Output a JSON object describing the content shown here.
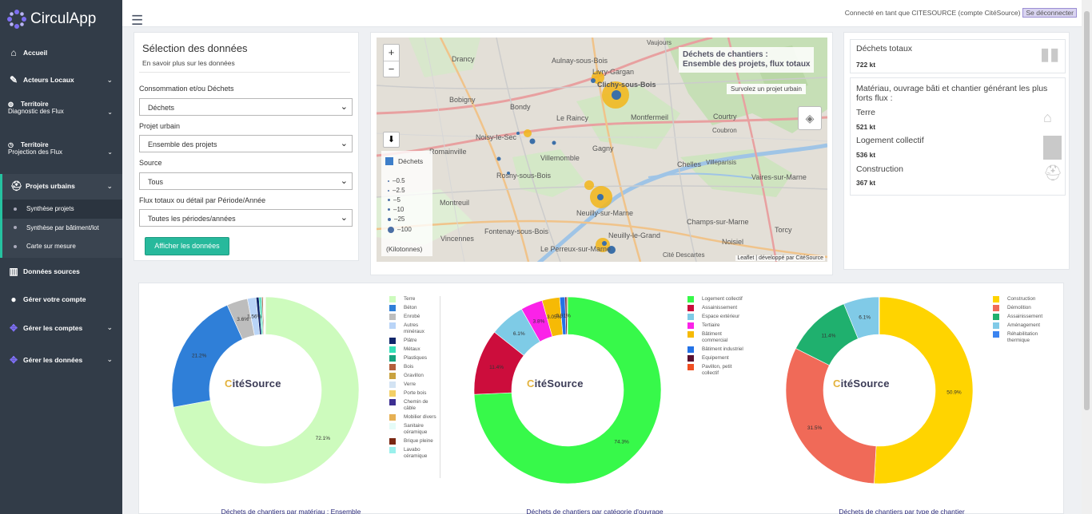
{
  "app": {
    "name": "CirculApp"
  },
  "header": {
    "connected_text": "Connecté en tant que CITESOURCE (compte CitéSource)",
    "logout_label": "Se déconnecter"
  },
  "sidebar": {
    "accueil": "Accueil",
    "acteurs": "Acteurs Locaux",
    "territoire1": {
      "title": "Territoire",
      "sub": "Diagnostic des Flux"
    },
    "territoire2": {
      "title": "Territoire",
      "sub": "Projection des Flux"
    },
    "projets": "Projets urbains",
    "sub_items": [
      "Synthèse projets",
      "Synthèse par bâtiment/lot",
      "Carte sur mesure"
    ],
    "donnees_sources": "Données sources",
    "gerer_compte": "Gérer votre compte",
    "gerer_comptes": "Gérer les comptes",
    "gerer_donnees": "Gérer les données"
  },
  "selection": {
    "title": "Sélection des données",
    "subtitle": "En savoir plus sur les données",
    "f1_label": "Consommation et/ou Déchets",
    "f1_value": "Déchets",
    "f2_label": "Projet urbain",
    "f2_value": "Ensemble des projets",
    "f3_label": "Source",
    "f3_value": "Tous",
    "f4_label": "Flux totaux ou détail par Période/Année",
    "f4_value": "Toutes les périodes/années",
    "button": "Afficher les données"
  },
  "map": {
    "zoom_in": "+",
    "zoom_out": "−",
    "title_l1": "Déchets de chantiers :",
    "title_l2": "Ensemble des projets, flux totaux",
    "survol": "Survolez un projet urbain",
    "legend_head": "Déchets",
    "legend_values": [
      "0.5",
      "2.5",
      "5",
      "10",
      "25",
      "100"
    ],
    "legend_unit": "(Kilotonnes)",
    "attribution": "Leaflet | développé par CitéSource",
    "towns": [
      {
        "n": "Drancy"
      },
      {
        "n": "Aulnay-sous-Bois"
      },
      {
        "n": "Livry-Gargan"
      },
      {
        "n": "Clichy-sous-Bois"
      },
      {
        "n": "Vaujours"
      },
      {
        "n": "Bobigny"
      },
      {
        "n": "Bondy"
      },
      {
        "n": "Le Raincy"
      },
      {
        "n": "Montfermeil"
      },
      {
        "n": "Noisy-le-Sec"
      },
      {
        "n": "Romainville"
      },
      {
        "n": "Villemomble"
      },
      {
        "n": "Gagny"
      },
      {
        "n": "Courtry"
      },
      {
        "n": "Rosny-sous-Bois"
      },
      {
        "n": "Chelles"
      },
      {
        "n": "Vaires-sur-Marne"
      },
      {
        "n": "Montreuil"
      },
      {
        "n": "Neuilly-sur-Marne"
      },
      {
        "n": "Fontenay-sous-Bois"
      },
      {
        "n": "Champs-sur-Marne"
      },
      {
        "n": "Vincennes"
      },
      {
        "n": "Neuilly-le-Grand"
      },
      {
        "n": "Noisiel"
      },
      {
        "n": "Torcy"
      },
      {
        "n": "Le Perreux-sur-Marne"
      },
      {
        "n": "Cité Descartes"
      },
      {
        "n": "Coubron"
      },
      {
        "n": "Villeparisis"
      }
    ]
  },
  "kpis": {
    "total_label": "Déchets totaux",
    "total_value": "722 kt",
    "max_title": "Matériau, ouvrage bâti et chantier générant les plus forts flux :",
    "items": [
      {
        "label": "Terre",
        "value": "521 kt"
      },
      {
        "label": "Logement collectif",
        "value": "536 kt"
      },
      {
        "label": "Construction",
        "value": "367 kt"
      }
    ]
  },
  "logo_text": {
    "c": "C",
    "rest": "itéSource"
  },
  "chart_data": [
    {
      "type": "pie",
      "title": "Déchets de chantiers par matériau : Ensemble",
      "categories": [
        "Terre",
        "Béton",
        "Enrobé",
        "Autres minéraux",
        "Plâtre",
        "Métaux",
        "Plastiques",
        "Bois",
        "Gravillon",
        "Verre",
        "Porte bois",
        "Chemin de câble",
        "Mobilier divers",
        "Sanitaire céramique",
        "Brique pleine",
        "Lavabo céramique"
      ],
      "values": [
        72.1,
        21.2,
        3.6,
        1.5,
        0.5,
        0.3,
        0.2,
        0.2,
        0.1,
        0.1,
        0.05,
        0.05,
        0.04,
        0.03,
        0.02,
        0.01
      ],
      "colors": [
        "#cdfbbd",
        "#2f7fd8",
        "#bdbdbd",
        "#b9d4f7",
        "#10266b",
        "#36e0b8",
        "#15a37e",
        "#b55e3c",
        "#c9a23f",
        "#d3e3f3",
        "#f3d066",
        "#3d2f92",
        "#e6b054",
        "#e5fbf7",
        "#7a2712",
        "#9af0ec"
      ],
      "labels": [
        {
          "i": 0,
          "t": "72.1%"
        },
        {
          "i": 1,
          "t": "21.2%"
        },
        {
          "i": 2,
          "t": "3.6%"
        },
        {
          "i": 3,
          "t": "1.56%"
        }
      ]
    },
    {
      "type": "pie",
      "title": "Déchets de chantiers par catégorie d'ouvrage",
      "categories": [
        "Logement collectif",
        "Assainissement",
        "Espace extérieur",
        "Tertiaire",
        "Bâtiment commercial",
        "Bâtiment industriel",
        "Equipement",
        "Pavillon, petit collectif"
      ],
      "values": [
        74.3,
        11.4,
        6.1,
        3.8,
        3.05,
        0.91,
        0.3,
        0.14
      ],
      "colors": [
        "#37f94a",
        "#cc0d3c",
        "#7ecbe6",
        "#fb22e8",
        "#f6ba05",
        "#2372e6",
        "#5a1030",
        "#f04f22"
      ],
      "labels": [
        {
          "i": 0,
          "t": "74.3%"
        },
        {
          "i": 1,
          "t": "11.4%"
        },
        {
          "i": 2,
          "t": "6.1%"
        },
        {
          "i": 3,
          "t": "3.8%"
        },
        {
          "i": 4,
          "t": "3.05%"
        },
        {
          "i": 5,
          "t": "0.91%"
        }
      ]
    },
    {
      "type": "pie",
      "title": "Déchets de chantiers par type de chantier",
      "categories": [
        "Construction",
        "Démolition",
        "Assainissement",
        "Aménagement",
        "Réhabilitation thermique"
      ],
      "values": [
        50.9,
        31.5,
        11.4,
        6.1,
        0.1
      ],
      "colors": [
        "#ffd400",
        "#f06a58",
        "#1fb06e",
        "#80cae7",
        "#3b84f0"
      ],
      "labels": [
        {
          "i": 0,
          "t": "50.9%"
        },
        {
          "i": 1,
          "t": "31.5%"
        },
        {
          "i": 2,
          "t": "11.4%"
        },
        {
          "i": 3,
          "t": "6.1%"
        }
      ]
    }
  ]
}
